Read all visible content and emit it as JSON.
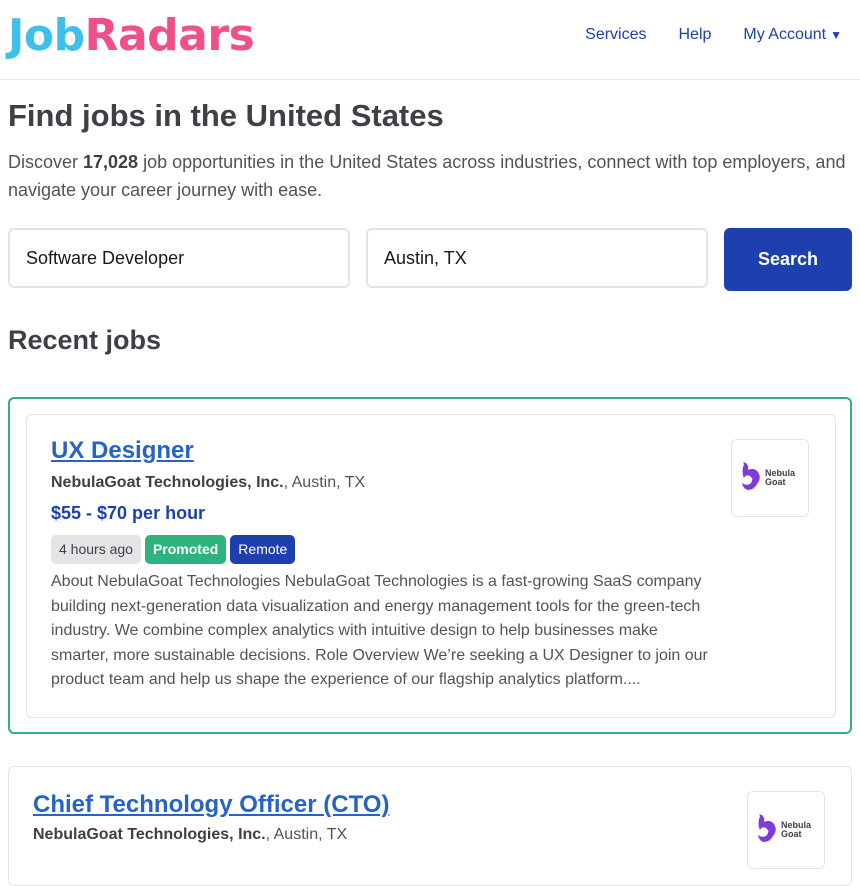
{
  "header": {
    "logo_part1": "Job",
    "logo_part2": "Radars",
    "nav": {
      "services": "Services",
      "help": "Help",
      "account": "My Account",
      "account_caret": "▼"
    }
  },
  "hero": {
    "title": "Find jobs in the United States",
    "intro_prefix": "Discover ",
    "job_count": "17,028",
    "intro_suffix": " job opportunities in the United States across industries, connect with top employers, and navigate your career journey with ease."
  },
  "search": {
    "keyword_value": "Software Developer",
    "location_value": "Austin, TX",
    "button_label": "Search"
  },
  "recent": {
    "heading": "Recent jobs"
  },
  "jobs": [
    {
      "title": "UX Designer",
      "company": "NebulaGoat Technologies, Inc.",
      "location": ", Austin, TX",
      "salary": "$55 - $70 per hour",
      "posted": "4 hours ago",
      "promoted": "Promoted",
      "remote": "Remote",
      "description": "About NebulaGoat Technologies NebulaGoat Technologies is a fast-growing SaaS company building next-generation data visualization and energy management tools for the green-tech industry. We combine complex analytics with intuitive design to help businesses make smarter, more sustainable decisions. Role Overview We’re seeking a UX Designer to join our product team and help us shape the experience of our flagship analytics platform....",
      "logo_line1": "Nebula",
      "logo_line2": "Goat"
    },
    {
      "title": "Chief Technology Officer (CTO)",
      "company": "NebulaGoat Technologies, Inc.",
      "location": ", Austin, TX",
      "logo_line1": "Nebula",
      "logo_line2": "Goat"
    }
  ],
  "colors": {
    "brand_blue": "#1e40af",
    "logo_cyan": "#3dc0ea",
    "logo_pink": "#f0508a",
    "promoted_green": "#2db37e"
  }
}
